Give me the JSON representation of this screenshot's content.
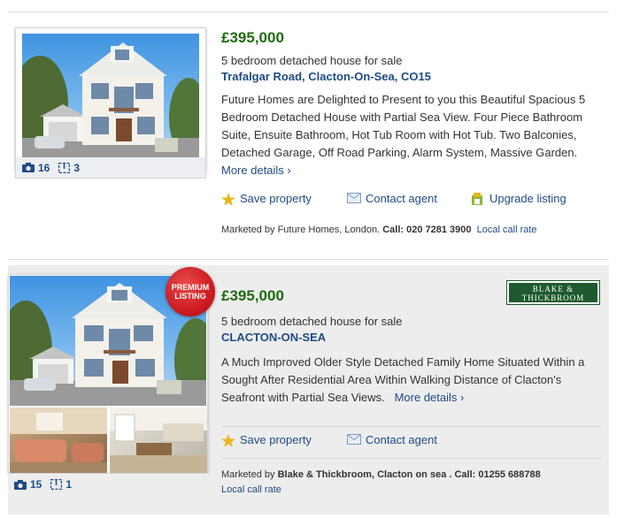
{
  "listings": [
    {
      "price": "£395,000",
      "type": "5 bedroom detached house for sale",
      "address": "Trafalgar Road, Clacton-On-Sea, CO15",
      "description": "Future Homes are Delighted to Present to you this Beautiful Spacious 5 Bedroom Detached House with Partial Sea View. Four Piece Bathroom Suite, Ensuite Bathroom, Hot Tub Room with Hot Tub. Two Balconies, Detached Garage, Off Road Parking, Alarm System, Massive Garden.",
      "more_details": "More details ›",
      "photos": "16",
      "floorplans": "3",
      "actions": {
        "save": "Save property",
        "contact": "Contact agent",
        "upgrade": "Upgrade listing"
      },
      "marketed_prefix": "Marketed by Future Homes, London.",
      "call_label": "Call: 020 7281 3900",
      "local_rate": "Local call rate"
    },
    {
      "price": "£395,000",
      "type": "5 bedroom detached house for sale",
      "address": "CLACTON-ON-SEA",
      "description": "A Much Improved Older Style Detached Family Home Situated Within a Sought After Residential Area Within Walking Distance of Clacton's Seafront with Partial Sea Views.",
      "more_details": "More details ›",
      "photos": "15",
      "floorplans": "1",
      "badge": [
        "PREMIUM",
        "LISTING"
      ],
      "agent_logo": [
        "BLAKE &",
        "THICKBROOM"
      ],
      "actions": {
        "save": "Save property",
        "contact": "Contact agent"
      },
      "marketed_prefix": "Marketed by",
      "marketed_agent": "Blake & Thickbroom, Clacton on sea",
      "call_label": ". Call: 01255 688788",
      "local_rate": "Local call rate"
    }
  ],
  "colors": {
    "price": "#1e6b0e",
    "link": "#1f4b86",
    "badge": "#c8161d",
    "logo": "#1e5a2e"
  }
}
